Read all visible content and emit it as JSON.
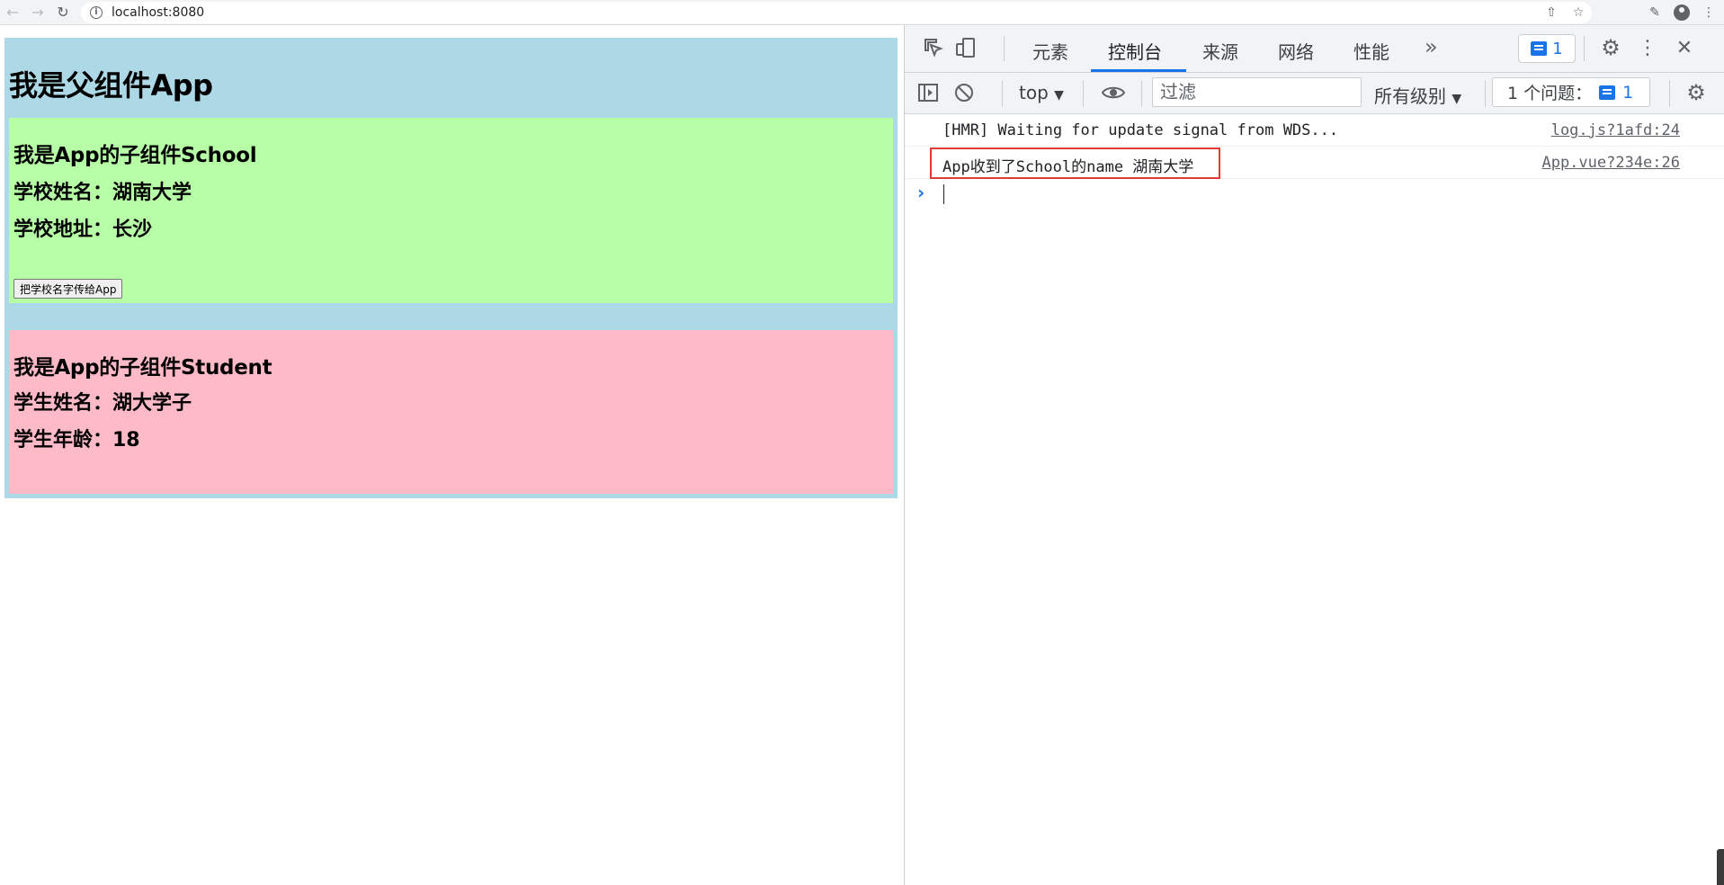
{
  "browser": {
    "url": "localhost:8080"
  },
  "page": {
    "app_title": "我是父组件App",
    "school": {
      "heading": "我是App的子组件School",
      "name_line": "学校姓名：湖南大学",
      "address_line": "学校地址：长沙",
      "button_label": "把学校名字传给App"
    },
    "student": {
      "heading": "我是App的子组件Student",
      "name_line": "学生姓名：湖大学子",
      "age_line": "学生年龄：18"
    }
  },
  "devtools": {
    "tabs": [
      "元素",
      "控制台",
      "来源",
      "网络",
      "性能"
    ],
    "active_tab": "控制台",
    "issue_count": "1",
    "toolbar": {
      "context": "top",
      "filter_placeholder": "过滤",
      "levels": "所有级别",
      "issues_label": "1 个问题：",
      "issues_count": "1"
    },
    "console": [
      {
        "message": "[HMR] Waiting for update signal from WDS...",
        "source": "log.js?1afd:24"
      },
      {
        "message": "App收到了School的name 湖南大学",
        "source": "App.vue?234e:26"
      }
    ]
  },
  "colors": {
    "app_bg": "#add8e6",
    "school_bg": "#b7ffa6",
    "student_bg": "#ffbac8",
    "accent": "#1a73e8",
    "highlight": "#e53935"
  }
}
